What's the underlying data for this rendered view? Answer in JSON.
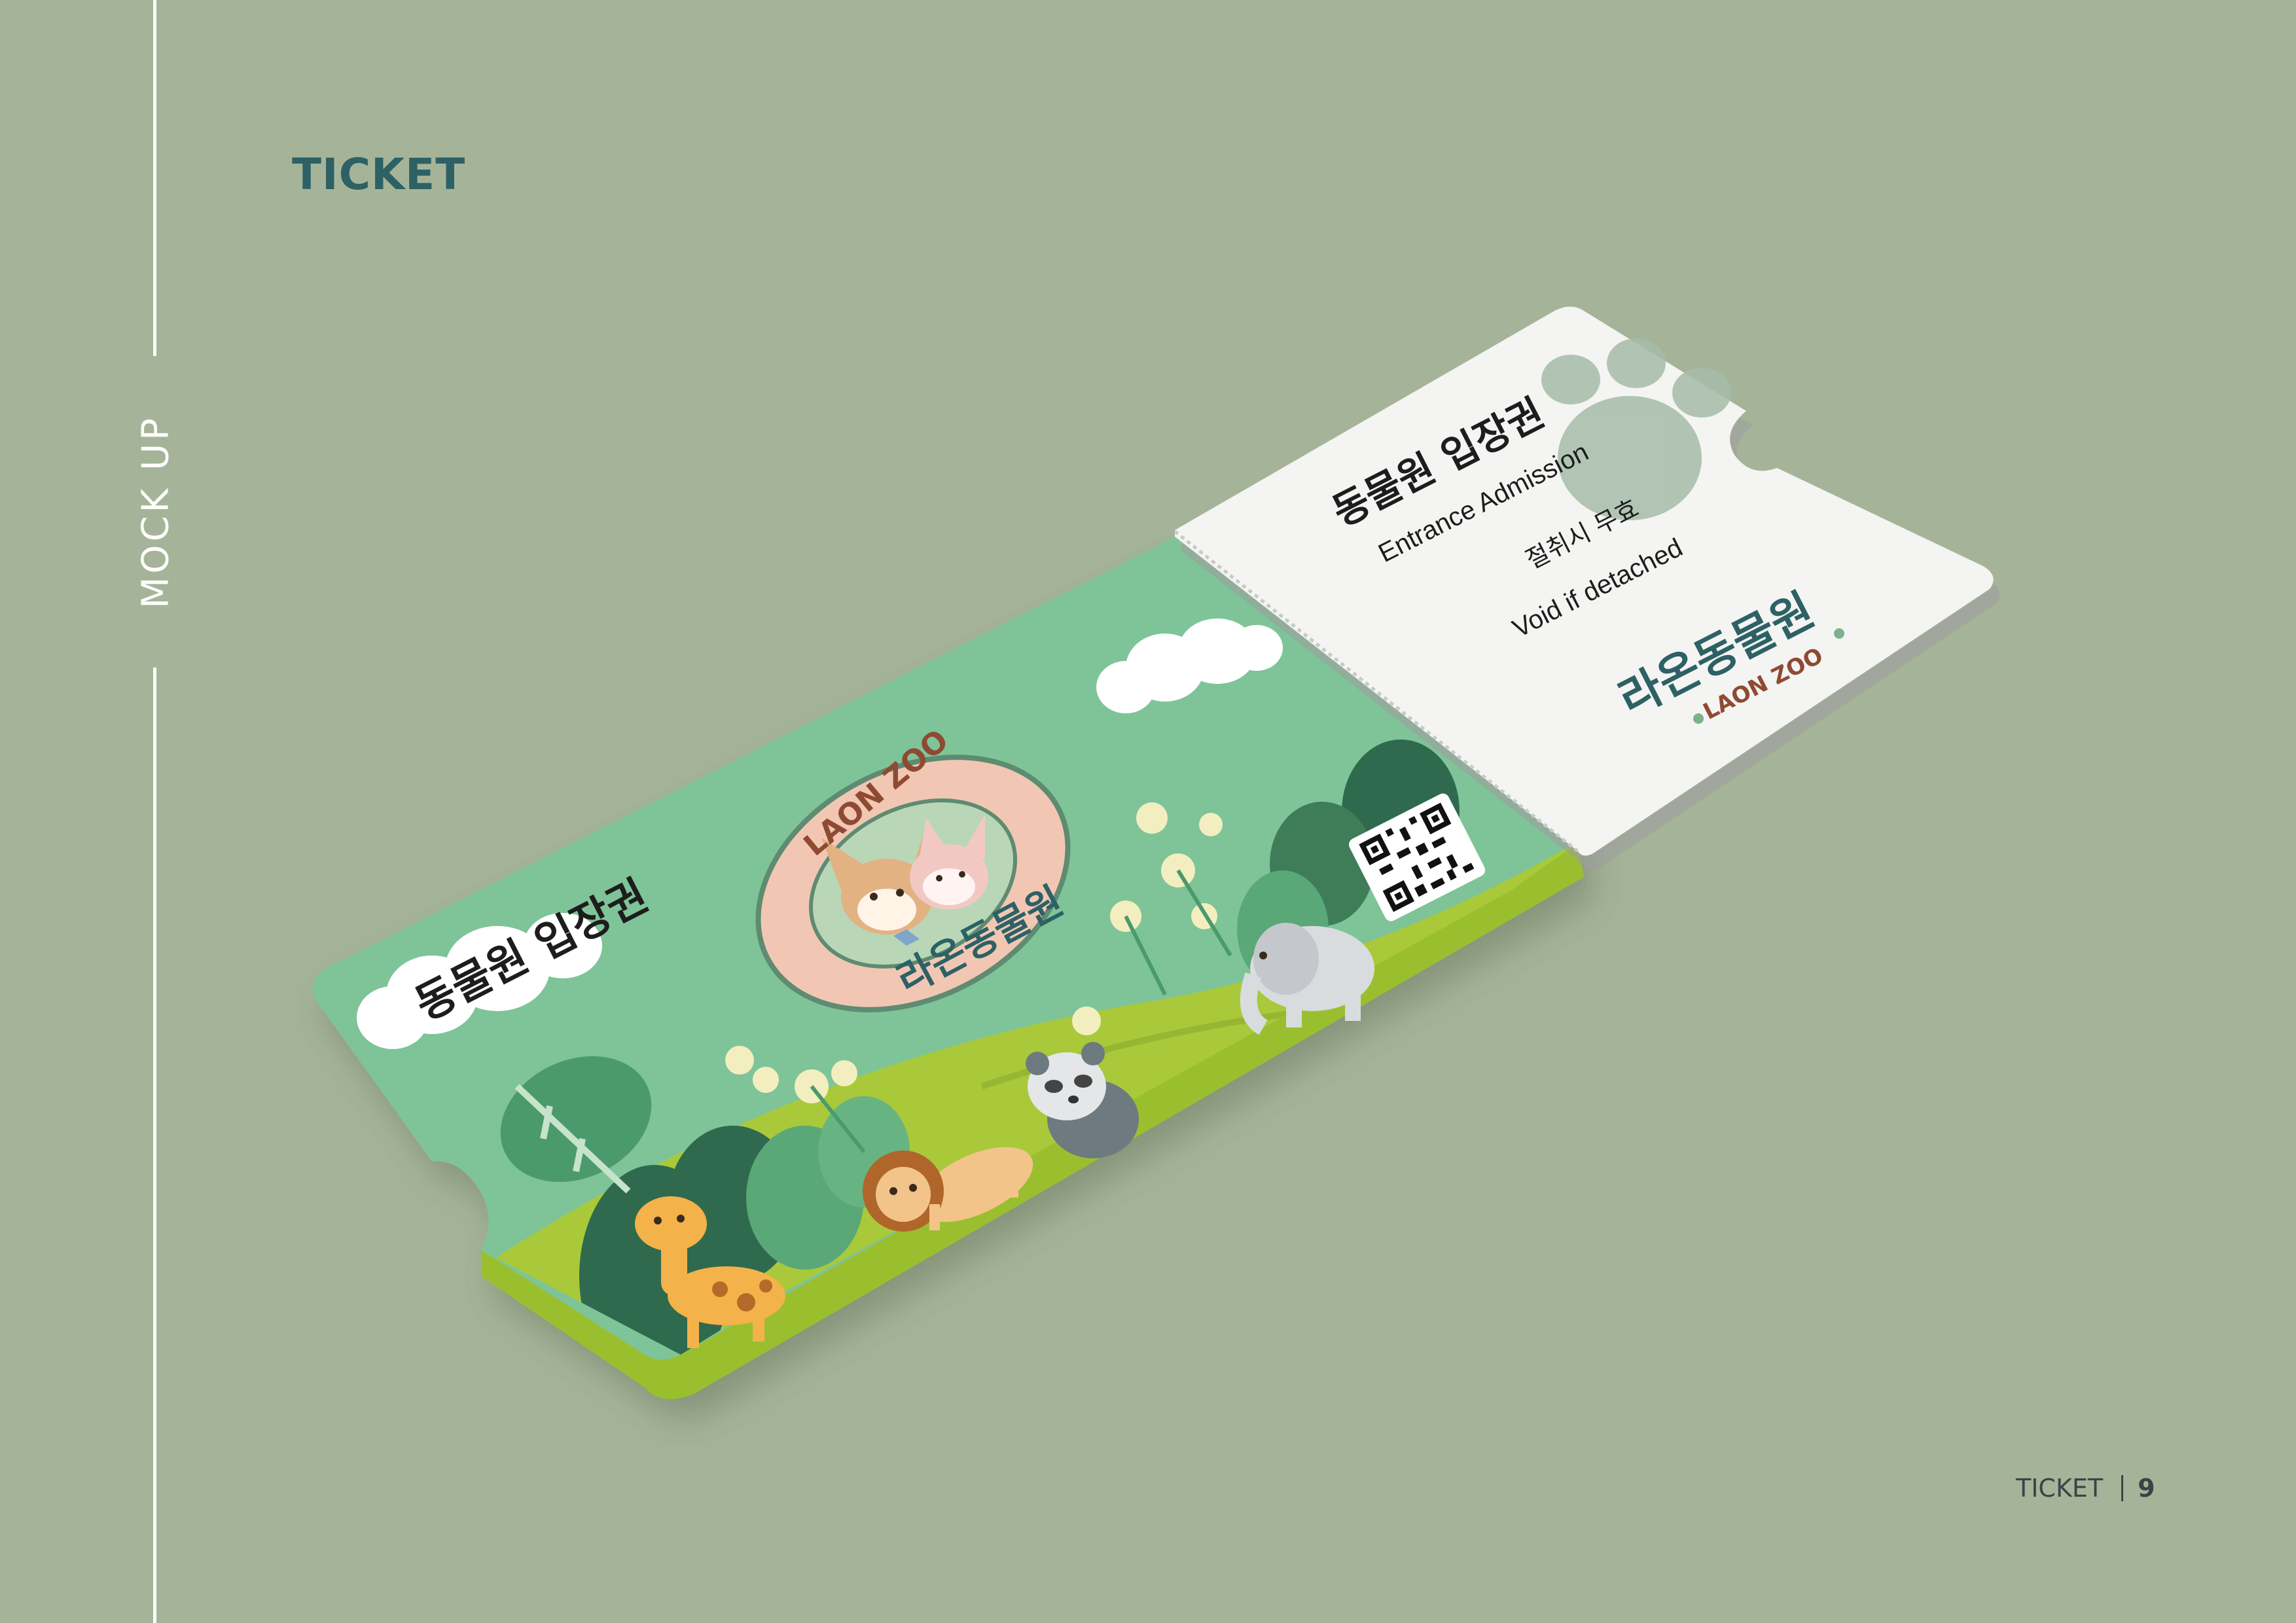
{
  "section_title": "TICKET",
  "side_label": "MOCK UP",
  "footer": {
    "label": "TICKET",
    "page_number": "9"
  },
  "ticket": {
    "main_title": "동물원 입장권",
    "badge_top": "LAON ZOO",
    "badge_bottom": "라온동물원",
    "stub_title": "동물원 입장권",
    "stub_subtitle": "Entrance Admission",
    "stub_void_kr": "절취시 무효",
    "stub_void_en": "Void if detached",
    "logo_kr": "라온동물원",
    "logo_en": "LAON ZOO"
  },
  "colors": {
    "background": "#a5b498",
    "ticket_green": "#7ec498",
    "ground_green": "#a9c93a",
    "dark_green": "#2f6a4f",
    "stub_white": "#f4f4f2",
    "brand_teal": "#2d6165",
    "brand_brown": "#8e4a32"
  }
}
